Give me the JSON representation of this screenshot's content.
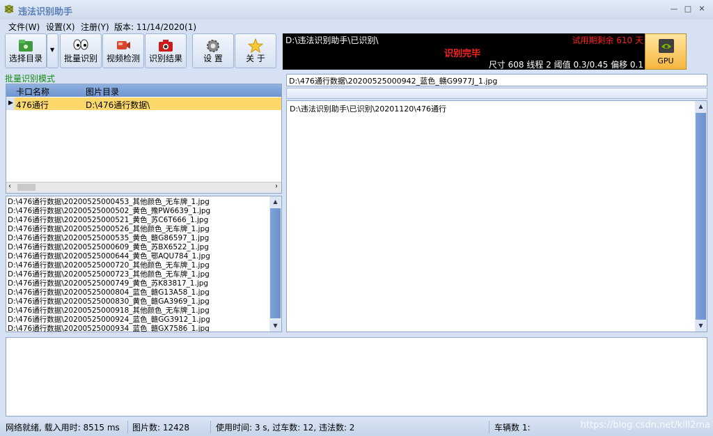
{
  "window": {
    "title": "违法识别助手"
  },
  "menu": [
    {
      "label": "文件(W)"
    },
    {
      "label": "设置(X)"
    },
    {
      "label": "注册(Y)"
    },
    {
      "label": "版本: 11/14/2020(1)"
    }
  ],
  "toolbar": {
    "select_dir": "选择目录",
    "batch": "批量识别",
    "video": "视频检测",
    "results": "识别结果",
    "settings": "设 置",
    "about": "关 于"
  },
  "panel": {
    "path": "D:\\违法识别助手\\已识别\\",
    "trial": "试用期剩余 610 天",
    "status": "识别完毕",
    "stats": "尺寸 608    线程 2    阈值 0.3/0.45 偏移 0.1",
    "gpu": "GPU"
  },
  "left": {
    "mode_label": "批量识别模式",
    "columns": [
      "卡口名称",
      "图片目录"
    ],
    "rows": [
      {
        "name": "476通行",
        "dir": "D:\\476通行数据\\"
      }
    ],
    "files": [
      "D:\\476通行数据\\20200525000453_其他颜色_无车牌_1.jpg",
      "D:\\476通行数据\\20200525000502_黄色_豫PW6639_1.jpg",
      "D:\\476通行数据\\20200525000521_黄色_苏C6T666_1.jpg",
      "D:\\476通行数据\\20200525000526_其他颜色_无车牌_1.jpg",
      "D:\\476通行数据\\20200525000535_黄色_赣G86597_1.jpg",
      "D:\\476通行数据\\20200525000609_黄色_苏BX6522_1.jpg",
      "D:\\476通行数据\\20200525000644_黄色_鄂AQU784_1.jpg",
      "D:\\476通行数据\\20200525000720_其他颜色_无车牌_1.jpg",
      "D:\\476通行数据\\20200525000723_其他颜色_无车牌_1.jpg",
      "D:\\476通行数据\\20200525000749_黄色_苏K83817_1.jpg",
      "D:\\476通行数据\\20200525000804_蓝色_赣G13A58_1.jpg",
      "D:\\476通行数据\\20200525000830_黄色_赣GA3969_1.jpg",
      "D:\\476通行数据\\20200525000918_其他颜色_无车牌_1.jpg",
      "D:\\476通行数据\\20200525000924_蓝色_赣GG3912_1.jpg",
      "D:\\476通行数据\\20200525000934_蓝色_赣GX7586_1.jpg"
    ]
  },
  "right": {
    "current_file": "D:\\476通行数据\\20200525000942_蓝色_赣G9977J_1.jpg",
    "output_dir": "D:\\违法识别助手\\已识别\\20201120\\476通行"
  },
  "status": {
    "network": "网络就绪, 载入用时: 8515 ms",
    "images": "图片数: 12428",
    "usage": "使用时间: 3 s, 过车数: 12, 违法数: 2",
    "vehicles": "车辆数 1:",
    "watermark": "https://blog.csdn.net/kill2ma"
  }
}
